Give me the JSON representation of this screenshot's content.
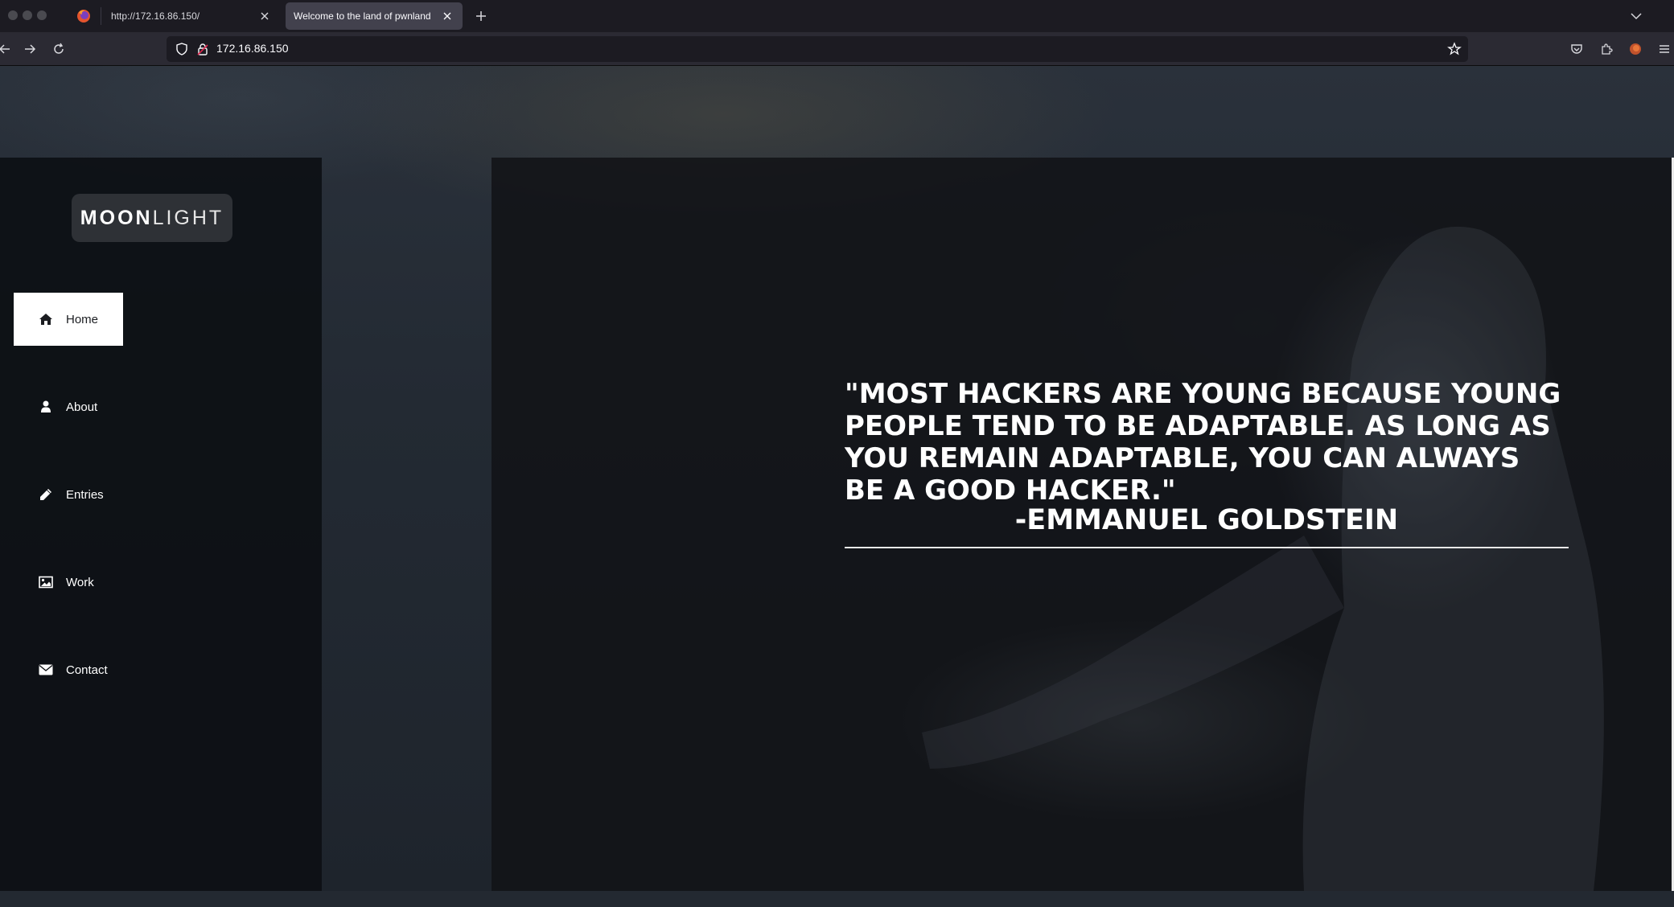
{
  "browser": {
    "tabs": [
      {
        "title": "http://172.16.86.150/",
        "active": false
      },
      {
        "title": "Welcome to the land of pwnland",
        "active": true
      }
    ],
    "url": "172.16.86.150"
  },
  "site": {
    "logo_bold": "MOON",
    "logo_light": "LIGHT",
    "menu": [
      {
        "label": "Home",
        "icon": "home-icon",
        "active": true
      },
      {
        "label": "About",
        "icon": "user-icon",
        "active": false
      },
      {
        "label": "Entries",
        "icon": "pencil-icon",
        "active": false
      },
      {
        "label": "Work",
        "icon": "image-icon",
        "active": false
      },
      {
        "label": "Contact",
        "icon": "envelope-icon",
        "active": false
      }
    ]
  },
  "main": {
    "quote": "\"MOST HACKERS ARE YOUNG BECAUSE YOUNG PEOPLE TEND TO BE ADAPTABLE. AS LONG AS YOU REMAIN ADAPTABLE, YOU CAN ALWAYS BE A GOOD HACKER.\"",
    "author": "-EMMANUEL GOLDSTEIN"
  },
  "colors": {
    "chrome_bg": "#1c1b22",
    "toolbar_bg": "#2b2a33",
    "sidebar_bg": "#0d1014",
    "active_menu_bg": "#ffffff",
    "text": "#ffffff"
  }
}
